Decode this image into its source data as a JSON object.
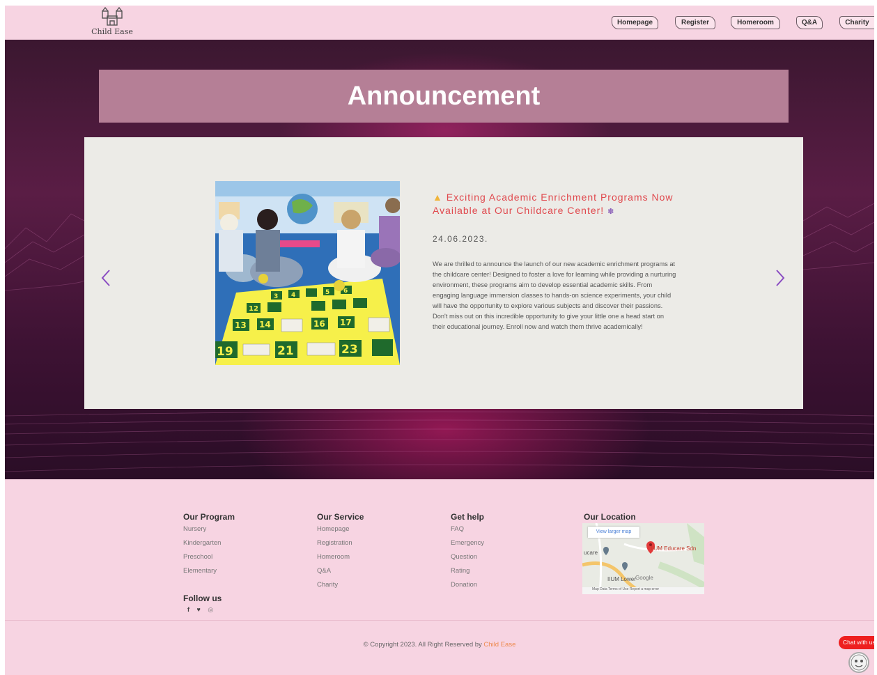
{
  "brand": {
    "name": "Child Ease"
  },
  "nav": {
    "items": [
      {
        "label": "Homepage"
      },
      {
        "label": "Register"
      },
      {
        "label": "Homeroom"
      },
      {
        "label": "Q&A"
      },
      {
        "label": "Charity"
      }
    ]
  },
  "hero": {
    "title": "Announcement"
  },
  "announcement": {
    "heading": "Exciting Academic Enrichment Programs Now Available at Our Childcare Center!",
    "date": "24.06.2023.",
    "body": "We are thrilled to announce the launch of our new academic enrichment programs at the childcare center! Designed to foster a love for learning while providing a nurturing environment, these programs aim to develop essential academic skills. From engaging language immersion classes to hands-on science experiments, your child will have the opportunity to explore various subjects and discover their passions. Don't miss out on this incredible opportunity to give your little one a head start on their educational journey. Enroll now and watch them thrive academically!",
    "board_numbers": [
      "3",
      "4",
      "5",
      "6",
      "12",
      "13",
      "14",
      "16",
      "17",
      "19",
      "21",
      "23"
    ]
  },
  "footer": {
    "program": {
      "title": "Our Program",
      "items": [
        "Nursery",
        "Kindergarten",
        "Preschool",
        "Elementary"
      ]
    },
    "service": {
      "title": "Our Service",
      "items": [
        "Homepage",
        "Registration",
        "Homeroom",
        "Q&A",
        "Charity"
      ]
    },
    "help": {
      "title": "Get help",
      "items": [
        "FAQ",
        "Emergency",
        "Question",
        "Rating",
        "Donation"
      ]
    },
    "location": {
      "title": "Our Location",
      "map_button": "View larger map",
      "place_label": "IIUM Educare Sdn",
      "left_label": "ucare",
      "bottom_label": "IIUM Lower",
      "google": "Google",
      "attribution": "Map Data  Terms of Use   Report a map error"
    },
    "follow": {
      "title": "Follow us"
    },
    "copyright": {
      "text": "© Copyright 2023. All Right Reserved by ",
      "brand": "Child Ease"
    },
    "chat": {
      "label": "Chat with us"
    }
  },
  "colors": {
    "nav_bg": "#f7d4e2",
    "title_bar": "#b57f96",
    "heading_red": "#e0484d",
    "chat_red": "#ee1f1f"
  },
  "icons": [
    "castle-logo-icon",
    "chevron-left-icon",
    "chevron-right-icon",
    "facebook-icon",
    "twitter-icon",
    "instagram-icon",
    "map-pin-icon",
    "chatbot-avatar-icon"
  ]
}
